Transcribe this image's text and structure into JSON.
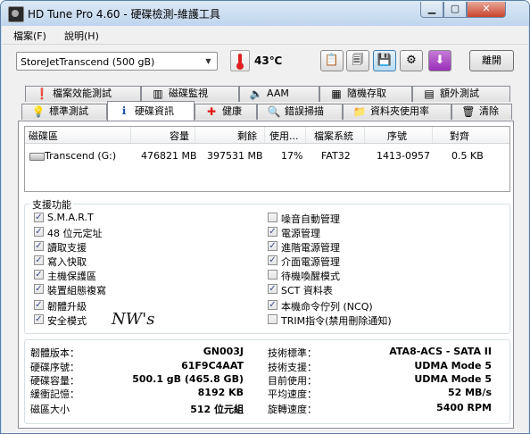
{
  "window": {
    "title": "HD Tune Pro 4.60 - 硬碟檢測-維護工具",
    "min_icon": "minimize-icon",
    "max_icon": "maximize-icon",
    "close_icon": "close-icon"
  },
  "menu": {
    "items": [
      "檔案(F)",
      "說明(H)"
    ]
  },
  "toolbar": {
    "drive_select_value": "StoreJetTranscend        (500 gB)",
    "temperature": "43℃",
    "exit_label": "離開",
    "buttons": [
      "copy-info-icon",
      "copy-screen-icon",
      "save-icon",
      "options-icon",
      "download-icon"
    ]
  },
  "tabs": {
    "row1": [
      {
        "label": "檔案效能測試",
        "icon": "file-benchmark-icon"
      },
      {
        "label": "磁碟監視",
        "icon": "disk-monitor-icon"
      },
      {
        "label": "AAM",
        "icon": "speaker-icon"
      },
      {
        "label": "隨機存取",
        "icon": "random-access-icon"
      },
      {
        "label": "額外測試",
        "icon": "extra-tests-icon"
      }
    ],
    "row2": [
      {
        "label": "標準測試",
        "icon": "bulb-icon"
      },
      {
        "label": "硬碟資訊",
        "icon": "info-icon"
      },
      {
        "label": "健康",
        "icon": "health-cross-icon"
      },
      {
        "label": "錯誤掃描",
        "icon": "magnifier-icon"
      },
      {
        "label": "資料夾使用率",
        "icon": "folder-icon"
      },
      {
        "label": "清除",
        "icon": "trash-icon"
      }
    ],
    "selected": "硬碟資訊"
  },
  "partitions": {
    "headers": [
      "磁碟區",
      "容量",
      "剩餘",
      "使用...",
      "檔案系統",
      "序號",
      "對齊"
    ],
    "rows": [
      {
        "volume": "Transcend (G:)",
        "capacity": "476821 MB",
        "free": "397531 MB",
        "usage": "17%",
        "filesystem": "FAT32",
        "serial": "1413-0957",
        "alignment": "0.5 KB"
      }
    ]
  },
  "features": {
    "title": "支援功能",
    "left": [
      {
        "label": "S.M.A.R.T",
        "checked": true
      },
      {
        "label": "48 位元定址",
        "checked": true
      },
      {
        "label": "讀取支援",
        "checked": true
      },
      {
        "label": "寫入快取",
        "checked": true
      },
      {
        "label": "主機保護區",
        "checked": true
      },
      {
        "label": "裝置組態複寫",
        "checked": true
      },
      {
        "label": "韌體升級",
        "checked": true
      },
      {
        "label": "安全模式",
        "checked": true
      }
    ],
    "right": [
      {
        "label": "噪音自動管理",
        "checked": false
      },
      {
        "label": "電源管理",
        "checked": true
      },
      {
        "label": "進階電源管理",
        "checked": true
      },
      {
        "label": "介面電源管理",
        "checked": true
      },
      {
        "label": "待機喚醒模式",
        "checked": false
      },
      {
        "label": "SCT 資料表",
        "checked": true
      },
      {
        "label": "本機命令佇列 (NCQ)",
        "checked": true
      },
      {
        "label": "TRIM指令(禁用刪除通知)",
        "checked": false
      }
    ],
    "signature": "NW's"
  },
  "info": {
    "left": [
      {
        "label": "韌體版本：",
        "value": "GN003J"
      },
      {
        "label": "硬碟序號：",
        "value": "61F9C4AAT"
      },
      {
        "label": "硬碟容量：",
        "value": "500.1 gB (465.8 GB)"
      },
      {
        "label": "緩衝記憶：",
        "value": "8192 KB"
      },
      {
        "label": "磁區大小",
        "value": "512 位元組"
      }
    ],
    "right": [
      {
        "label": "技術標準：",
        "value": "ATA8-ACS - SATA II"
      },
      {
        "label": "技術支援：",
        "value": "UDMA Mode 5"
      },
      {
        "label": "目前使用：",
        "value": "UDMA Mode 5"
      },
      {
        "label": "平均速度：",
        "value": "52 MB/s"
      },
      {
        "label": "旋轉速度：",
        "value": "5400 RPM"
      }
    ]
  }
}
